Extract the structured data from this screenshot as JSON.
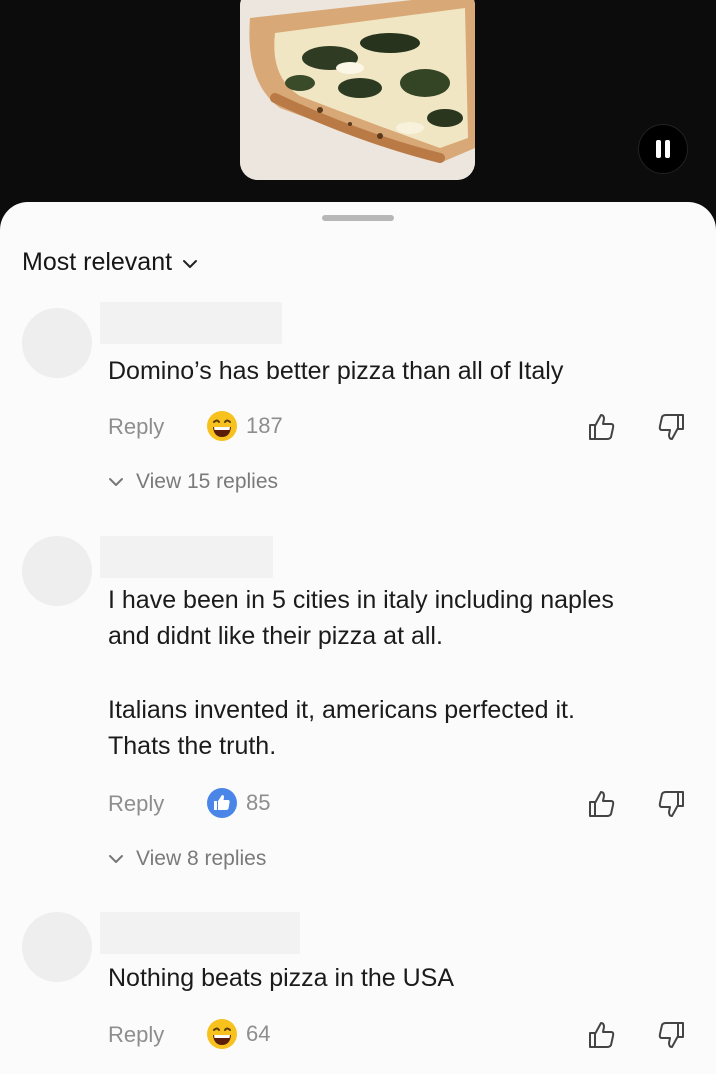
{
  "sort": {
    "label": "Most relevant",
    "icon": "chevron-down-icon"
  },
  "comments": [
    {
      "text": [
        "Domino’s has better pizza than all of Italy"
      ],
      "reply_label": "Reply",
      "reaction_icon": "laughing-emoji-icon",
      "reaction_count": "187",
      "view_replies": "View 15 replies"
    },
    {
      "text": [
        "I have been in 5 cities in italy including naples",
        "and didnt like their pizza at all.",
        "Italians invented it, americans perfected it.",
        "Thats the truth."
      ],
      "reply_label": "Reply",
      "reaction_icon": "like-badge-icon",
      "reaction_count": "85",
      "view_replies": "View 8 replies"
    },
    {
      "text": [
        "Nothing beats pizza in the USA"
      ],
      "reply_label": "Reply",
      "reaction_icon": "laughing-emoji-icon",
      "reaction_count": "64"
    }
  ],
  "colors": {
    "accent_like": "#4a86e8",
    "emoji_yellow": "#f7c21e",
    "sheet_bg": "#fbfbfb",
    "muted_text": "#8e8e8e"
  }
}
